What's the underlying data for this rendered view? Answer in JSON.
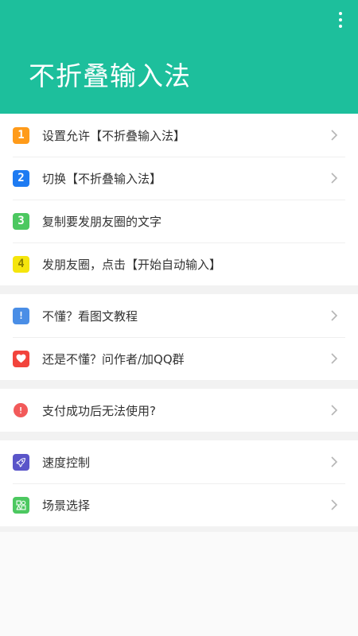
{
  "header": {
    "title": "不折叠输入法",
    "background": "#1dbf9c"
  },
  "groups": [
    {
      "items": [
        {
          "badge": "1",
          "color": "#ff9b1a",
          "label": "设置允许【不折叠输入法】",
          "chevron": true
        },
        {
          "badge": "2",
          "color": "#1e7bf2",
          "label": "切换【不折叠输入法】",
          "chevron": true
        },
        {
          "badge": "3",
          "color": "#4cc860",
          "label": "复制要发朋友圈的文字",
          "chevron": false
        },
        {
          "badge": "4",
          "color": "#f5e50d",
          "label": "发朋友圈，点击【开始自动输入】",
          "chevron": false
        }
      ]
    },
    {
      "items": [
        {
          "icon": "exclamation-square-icon",
          "color": "#4a8ee6",
          "label": "不懂？看图文教程",
          "chevron": true
        },
        {
          "icon": "heart-icon",
          "color": "#f2443c",
          "label": "还是不懂？问作者/加QQ群",
          "chevron": true
        }
      ]
    },
    {
      "items": [
        {
          "icon": "exclamation-circle-icon",
          "color": "#f25a5a",
          "label": "支付成功后无法使用?",
          "chevron": true
        }
      ]
    },
    {
      "items": [
        {
          "icon": "rocket-icon",
          "color": "#5a55c9",
          "label": "速度控制",
          "chevron": true
        },
        {
          "icon": "scene-icon",
          "color": "#4cc860",
          "label": "场景选择",
          "chevron": true
        }
      ]
    }
  ]
}
